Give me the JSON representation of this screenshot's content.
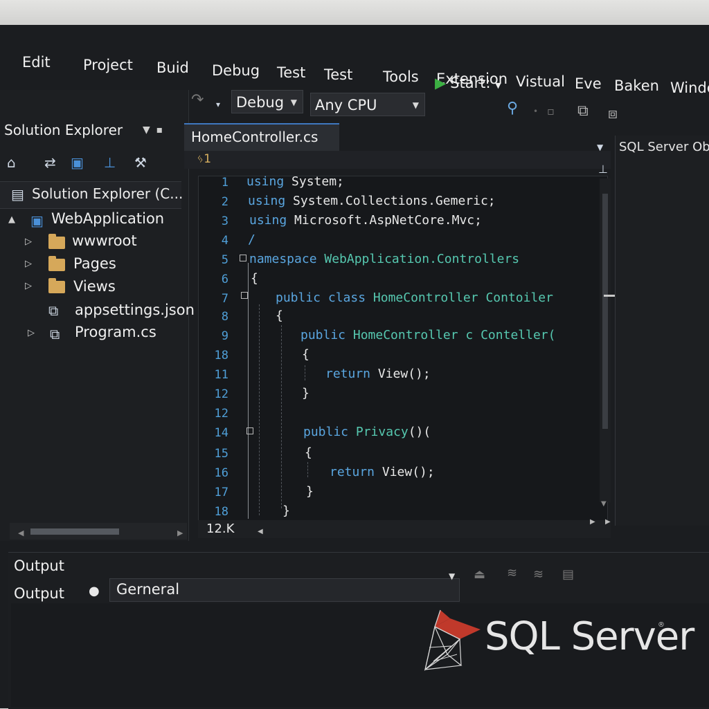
{
  "menu": [
    "Edit",
    "Project",
    "Buid",
    "Debug",
    "Test",
    "Test",
    "Tools",
    "Extension",
    "Vistual",
    "Eve",
    "Baken",
    "Windc"
  ],
  "toolbar": {
    "config": "Debug",
    "platform": "Any CPU",
    "start_label": "Start:",
    "icons": [
      "refresh-icon",
      "undo-icon",
      "open-icon",
      "save-icon",
      "redo-icon",
      "debug-target-icon"
    ]
  },
  "solution_explorer": {
    "title": "Solution Explorer",
    "search_label": "Solution Explorer (C...",
    "project": "WebApplication",
    "items": [
      {
        "label": "wwwroot",
        "type": "folder"
      },
      {
        "label": "Pages",
        "type": "folder"
      },
      {
        "label": "Views",
        "type": "folder"
      },
      {
        "label": "appsettings.json",
        "type": "file"
      },
      {
        "label": "Program.cs",
        "type": "file"
      }
    ]
  },
  "editor": {
    "tab": "HomeController.cs",
    "nav_ref": "1",
    "zoom": "12.K",
    "lines": [
      {
        "n": "1",
        "tokens": [
          {
            "t": "using ",
            "c": "kw"
          },
          {
            "t": "System;",
            "c": "pl"
          }
        ]
      },
      {
        "n": "2",
        "tokens": [
          {
            "t": "using ",
            "c": "kw"
          },
          {
            "t": "System.Collections.Gemeric;",
            "c": "pl"
          }
        ]
      },
      {
        "n": "3",
        "tokens": [
          {
            "t": "using ",
            "c": "kw"
          },
          {
            "t": "Microsoft.AspNetCore.Mvc;",
            "c": "pl"
          }
        ]
      },
      {
        "n": "4",
        "tokens": [
          {
            "t": "/",
            "c": "kw"
          }
        ]
      },
      {
        "n": "5",
        "tokens": [
          {
            "t": "namespace ",
            "c": "kw"
          },
          {
            "t": "WebApplication.Controllers",
            "c": "ty"
          }
        ]
      },
      {
        "n": "6",
        "tokens": [
          {
            "t": "{",
            "c": "pl"
          }
        ]
      },
      {
        "n": "7",
        "tokens": [
          {
            "t": "public class ",
            "c": "kw"
          },
          {
            "t": "HomeController Contoiler",
            "c": "ty"
          }
        ]
      },
      {
        "n": "8",
        "tokens": [
          {
            "t": "{",
            "c": "pl"
          }
        ]
      },
      {
        "n": "9",
        "tokens": [
          {
            "t": "public ",
            "c": "kw"
          },
          {
            "t": "HomeController c ",
            "c": "ty"
          },
          {
            "t": "Conteller(",
            "c": "ty"
          }
        ]
      },
      {
        "n": "18",
        "tokens": [
          {
            "t": "{",
            "c": "pl"
          }
        ]
      },
      {
        "n": "11",
        "tokens": [
          {
            "t": "return ",
            "c": "kw"
          },
          {
            "t": "View();",
            "c": "pl"
          }
        ]
      },
      {
        "n": "12",
        "tokens": [
          {
            "t": "}",
            "c": "pl"
          }
        ]
      },
      {
        "n": "12",
        "tokens": []
      },
      {
        "n": "14",
        "tokens": [
          {
            "t": "public ",
            "c": "kw"
          },
          {
            "t": "Privacy",
            "c": "ty"
          },
          {
            "t": "()(",
            "c": "pl"
          }
        ]
      },
      {
        "n": "15",
        "tokens": [
          {
            "t": "{",
            "c": "pl"
          }
        ]
      },
      {
        "n": "16",
        "tokens": [
          {
            "t": "return ",
            "c": "kw"
          },
          {
            "t": "View();",
            "c": "pl"
          }
        ]
      },
      {
        "n": "17",
        "tokens": [
          {
            "t": "}",
            "c": "pl"
          }
        ]
      },
      {
        "n": "18",
        "tokens": [
          {
            "t": "}",
            "c": "pl"
          }
        ]
      }
    ]
  },
  "sql_panel": {
    "title": "SQL Server Obje"
  },
  "output": {
    "title": "Output",
    "label": "Output",
    "source": "Gerneral"
  },
  "logo": {
    "text": "SQL Server",
    "tm": "®"
  },
  "colors": {
    "accent": "#3f78c0",
    "keyword": "#5aa6e0",
    "type": "#56c8b0",
    "play": "#3cb043",
    "logo_red": "#c0392b"
  }
}
